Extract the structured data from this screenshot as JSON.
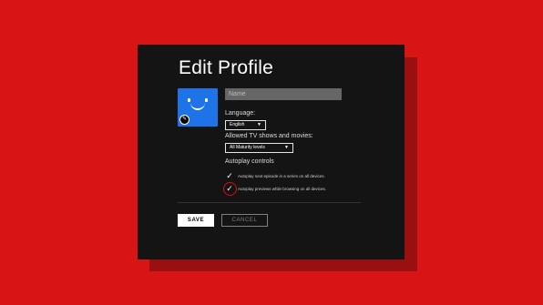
{
  "page": {
    "title": "Edit Profile"
  },
  "profile": {
    "avatar_icon": "smiley-face-icon",
    "edit_icon": "pencil-icon",
    "name_placeholder": "Name"
  },
  "language": {
    "label": "Language:",
    "selected": "English"
  },
  "maturity": {
    "label": "Allowed TV shows and movies:",
    "selected": "All Maturity levels"
  },
  "autoplay": {
    "heading": "Autoplay controls",
    "options": [
      {
        "label": "Autoplay next episode in a series on all devices.",
        "checked": true
      },
      {
        "label": "Autoplay previews while browsing on all devices.",
        "checked": true
      }
    ]
  },
  "actions": {
    "save_label": "SAVE",
    "cancel_label": "CANCEL"
  },
  "colors": {
    "background": "#d91414",
    "panel": "#141414",
    "avatar": "#1f73e8",
    "highlight": "#e50914"
  }
}
